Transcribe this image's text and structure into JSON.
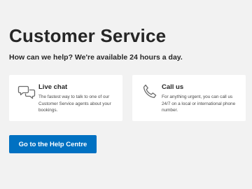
{
  "header": {
    "title": "Customer Service",
    "subtitle": "How can we help? We're available 24 hours a day."
  },
  "cards": [
    {
      "icon": "chat-bubbles-icon",
      "title": "Live chat",
      "text": "The fastest way to talk to one of our Customer Service agents about your bookings."
    },
    {
      "icon": "phone-icon",
      "title": "Call us",
      "text": "For anything urgent, you can call us 24/7 on a local or international phone number."
    }
  ],
  "cta": {
    "label": "Go to the Help Centre"
  },
  "colors": {
    "background": "#f2f2f2",
    "card": "#ffffff",
    "primary_button": "#0071c2",
    "text": "#262626",
    "icon_stroke": "#6b6b6b"
  }
}
